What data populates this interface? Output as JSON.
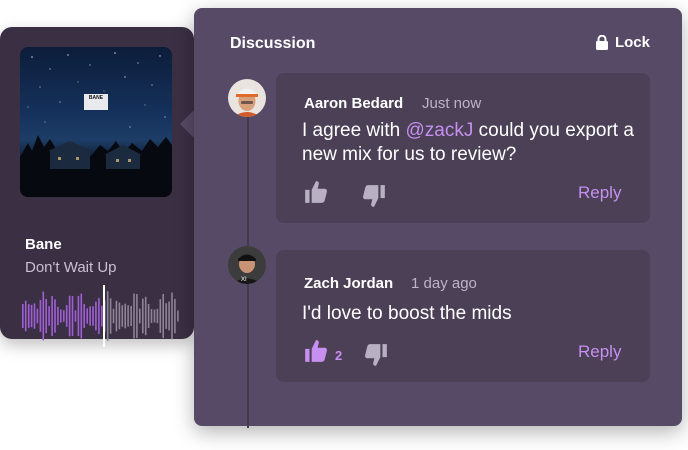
{
  "player": {
    "artist": "Bane",
    "track": "Don't Wait Up",
    "album_badge": "BANE"
  },
  "discussion": {
    "title": "Discussion",
    "lock_label": "Lock",
    "comments": [
      {
        "author": "Aaron Bedard",
        "time": "Just now",
        "text_before": "I agree with ",
        "mention": "@zackJ",
        "text_after": " could you export a new mix for us to review?",
        "likes": "",
        "liked": false,
        "reply_label": "Reply"
      },
      {
        "author": "Zach Jordan",
        "time": "1 day ago",
        "text_before": "I'd love to boost the mids",
        "mention": "",
        "text_after": "",
        "likes": "2",
        "liked": true,
        "reply_label": "Reply"
      }
    ]
  },
  "colors": {
    "accent": "#c68ff0",
    "panel": "#574a66",
    "comment_bg": "#4b4056",
    "player_bg": "#3b2f44"
  },
  "icons": [
    "lock-icon",
    "thumbs-up-icon",
    "thumbs-down-icon"
  ]
}
